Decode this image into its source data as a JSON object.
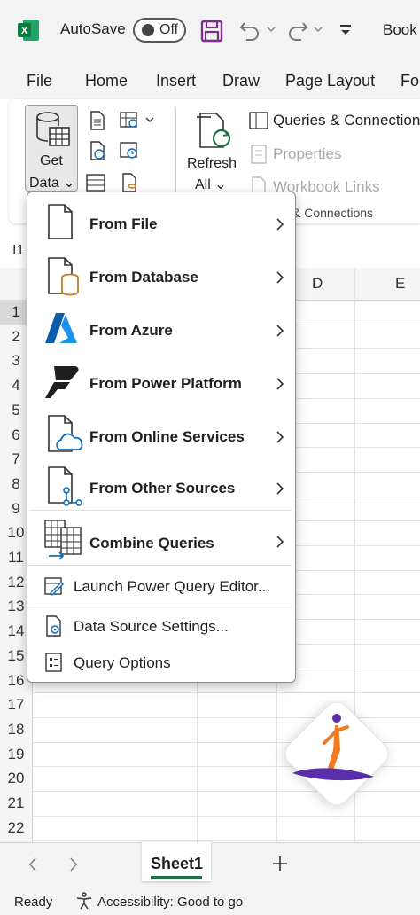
{
  "titlebar": {
    "autosave_label": "AutoSave",
    "autosave_state": "Off",
    "doc_title": "Book"
  },
  "ribbon_tabs": [
    "File",
    "Home",
    "Insert",
    "Draw",
    "Page Layout",
    "Fo"
  ],
  "ribbon": {
    "get_data_line1": "Get",
    "get_data_line2": "Data ⌄",
    "refresh_line1": "Refresh",
    "refresh_line2": "All ⌄",
    "queries_connections": "Queries & Connections",
    "properties": "Properties",
    "workbook_links": "Workbook Links",
    "group_label": "& Connections"
  },
  "namebox": "I1",
  "columns": [
    "D",
    "E"
  ],
  "rows": [
    "1",
    "2",
    "3",
    "4",
    "5",
    "6",
    "7",
    "8",
    "9",
    "10",
    "11",
    "12",
    "13",
    "14",
    "15",
    "16",
    "17",
    "18",
    "19",
    "20",
    "21",
    "22"
  ],
  "menu": {
    "items": [
      {
        "label": "From File",
        "icon": "file-icon",
        "submenu": true
      },
      {
        "label": "From Database",
        "icon": "database-icon",
        "submenu": true
      },
      {
        "label": "From Azure",
        "icon": "azure-icon",
        "submenu": true
      },
      {
        "label": "From Power Platform",
        "icon": "power-platform-icon",
        "submenu": true
      },
      {
        "label": "From Online Services",
        "icon": "cloud-file-icon",
        "submenu": true
      },
      {
        "label": "From Other Sources",
        "icon": "other-sources-icon",
        "submenu": true
      },
      {
        "label": "Combine Queries",
        "icon": "combine-icon",
        "submenu": true
      }
    ],
    "actions": [
      {
        "label": "Launch Power Query Editor...",
        "icon": "query-editor-icon"
      },
      {
        "label": "Data Source Settings...",
        "icon": "settings-icon"
      },
      {
        "label": "Query Options",
        "icon": "options-icon"
      }
    ]
  },
  "sheets": {
    "active": "Sheet1"
  },
  "status": {
    "ready": "Ready",
    "accessibility": "Accessibility: Good to go"
  },
  "colors": {
    "excel_green": "#217346",
    "accent_blue": "#0f6cbd",
    "azure_blue": "#0078d4",
    "database_orange": "#c77b1a",
    "brand_purple": "#5a2ea6",
    "brand_orange": "#f47a20"
  }
}
